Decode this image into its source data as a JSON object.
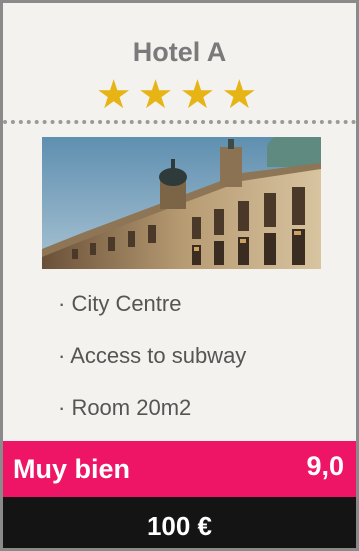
{
  "hotel": {
    "name": "Hotel A",
    "stars": 4,
    "star_glyph": "★★★★",
    "image_icon": "hotel-photo-image"
  },
  "features": [
    "· City Centre",
    "· Access to subway",
    "· Room 20m2"
  ],
  "rating": {
    "label": "Muy bien",
    "score": "9,0"
  },
  "price": "100 €",
  "colors": {
    "star": "#e7b416",
    "rating_bg": "#ee1466",
    "price_bg": "#141414",
    "card_bg": "#f3f2ee",
    "border": "#8a8a8a"
  }
}
